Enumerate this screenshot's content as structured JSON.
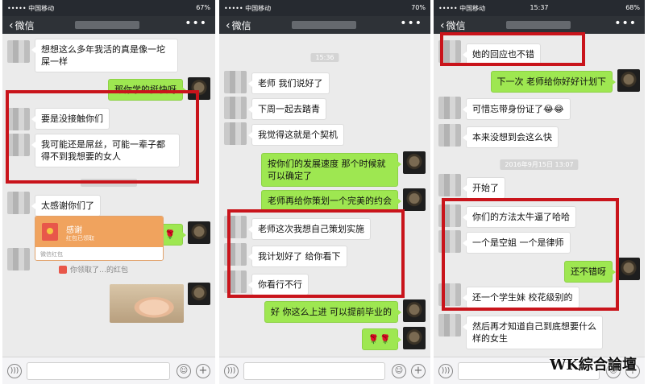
{
  "panels": [
    {
      "status": {
        "carrier": "••••• 中国移动",
        "time": "",
        "battery": "67%"
      },
      "nav": {
        "back_label": "微信",
        "more": "•••"
      },
      "messages": [
        "想想这么多年我活的真是像一坨屎一样",
        "那你学的挺快呀",
        "要是没接触你们",
        "我可能还是屌丝，可能一辈子都得不到我想要的女人",
        "太感谢你们了",
        "🌹🌹🌹"
      ],
      "redpacket": {
        "title": "感谢",
        "subtitle": "红包已领取",
        "footer": "微信红包"
      },
      "system_note": "你领取了…的红包"
    },
    {
      "status": {
        "carrier": "••••• 中国移动",
        "time": "",
        "battery": "70%"
      },
      "nav": {
        "back_label": "微信",
        "more": "•••"
      },
      "timestamp": "15:36",
      "messages": [
        "老师 我们说好了",
        "下周一起去踏青",
        "我觉得这就是个契机",
        "按你们的发展速度 那个时候就可以确定了",
        "老师再给你策划一个完美的约会",
        "老师这次我想自己策划实施",
        "我计划好了 给你看下",
        "你看行不行",
        "好 你这么上进 可以提前毕业的",
        "🌹🌹"
      ]
    },
    {
      "status": {
        "carrier": "••••• 中国移动",
        "time": "15:37",
        "battery": "68%"
      },
      "nav": {
        "back_label": "微信",
        "more": "•••"
      },
      "timestamp": "2016年9月15日 13:07",
      "messages": [
        "她的回应也不错",
        "下一次 老师给你好好计划下",
        "可惜忘带身份证了😂😂",
        "本来没想到会这么快",
        "开始了",
        "你们的方法太牛逼了哈哈",
        "一个是空姐 一个是律师",
        "还不错呀",
        "还一个学生妹 校花级别的",
        "然后再才知道自己到底想要什么样的女生"
      ]
    }
  ],
  "watermark": "WK綜合論壇",
  "colors": {
    "header": "#2e3237",
    "chat_bg": "#ebebeb",
    "bubble_green": "#9ee751",
    "highlight": "#c9141b"
  }
}
